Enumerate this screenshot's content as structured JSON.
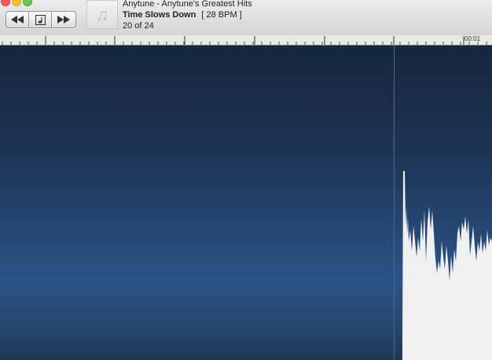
{
  "window": {
    "buttons": [
      "close",
      "minimize",
      "zoom"
    ]
  },
  "transport": {
    "rewind_icon": "rewind-icon",
    "sheet_icon": "sheet-music-icon",
    "forward_icon": "fast-forward-icon"
  },
  "now_playing": {
    "artwork_icon": "music-note-icon",
    "artwork_glyph": "♫",
    "artist_album": "Anytune - Anytune's Greatest Hits",
    "title": "Time Slows Down",
    "bpm": "[ 28 BPM ]",
    "position": "20 of 24"
  },
  "ruler": {
    "time_label": "00:01"
  },
  "colors": {
    "playhead": "#d23a2f",
    "waveform": "#f0f0f0",
    "background_top": "#16263d",
    "background_mid": "#2b5485"
  }
}
